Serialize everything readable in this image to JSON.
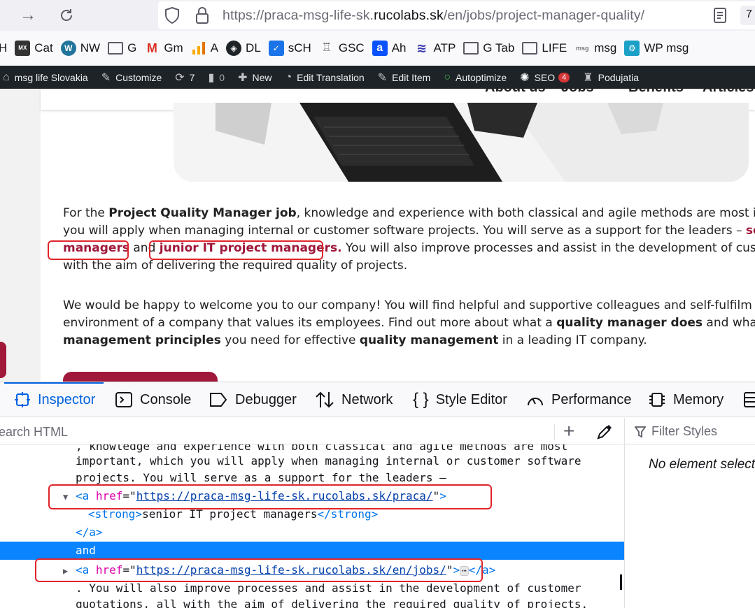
{
  "browser": {
    "url_prefix": "https://praca-msg-life-sk.",
    "url_domain": "rucolabs.sk",
    "url_path": "/en/jobs/project-manager-quality/",
    "extra_label": "7"
  },
  "bookmarks": [
    {
      "label": "H",
      "icon": "none"
    },
    {
      "label": "Cat",
      "icon": "mxs2-icon"
    },
    {
      "label": "NW",
      "icon": "wordpress-icon"
    },
    {
      "label": "G",
      "icon": "folder-icon"
    },
    {
      "label": "Gm",
      "icon": "gmail-icon"
    },
    {
      "label": "A",
      "icon": "analytics-icon"
    },
    {
      "label": "DL",
      "icon": "dl-icon"
    },
    {
      "label": "sCH",
      "icon": "check-icon"
    },
    {
      "label": "GSC",
      "icon": "gsc-icon"
    },
    {
      "label": "Ah",
      "icon": "ahrefs-icon"
    },
    {
      "label": "ATP",
      "icon": "atp-icon"
    },
    {
      "label": "G Tab",
      "icon": "folder-icon"
    },
    {
      "label": "LIFE",
      "icon": "folder-icon"
    },
    {
      "label": "msg",
      "icon": "msg-icon"
    },
    {
      "label": "WP msg",
      "icon": "wp-msg-icon"
    }
  ],
  "adminbar": {
    "site": "msg life Slovakia",
    "customize": "Customize",
    "updates": "7",
    "comments": "0",
    "new": "New",
    "edit_translation": "Edit Translation",
    "edit_item": "Edit Item",
    "autoptimize": "Autoptimize",
    "seo": "SEO",
    "seo_badge": "4",
    "podujatia": "Podujatia"
  },
  "site": {
    "nav": [
      "About us",
      "Jobs",
      "Benefits",
      "Articles"
    ]
  },
  "content": {
    "p1_l1_a": "For the ",
    "p1_l1_b": "Project Quality Manager job",
    "p1_l1_c": ", knowledge and experience with both classical and agile methods are most im",
    "p1_l2_a": "you will apply when managing internal or customer software projects. You will serve as a support for the leaders – ",
    "p1_l2_b": "se",
    "p1_l3_a": "managers",
    "p1_l3_b": " and ",
    "p1_l3_c": "junior IT project managers.",
    "p1_l3_d": " You will also improve processes and assist in the development of custom",
    "p1_l4": "with the aim of delivering the required quality of projects.",
    "p2_l1": "We would be happy to welcome you to our company! You will find helpful and supportive colleagues and self-fulfilm",
    "p2_l2_a": "environment of a company that values its employees. Find out more about what a ",
    "p2_l2_b": "quality manager does",
    "p2_l2_c": " and what c",
    "p2_l3_a": "management principles",
    "p2_l3_b": " you need for effective ",
    "p2_l3_c": "quality management",
    "p2_l3_d": " in a leading IT company."
  },
  "devtools": {
    "tabs": [
      "Inspector",
      "Console",
      "Debugger",
      "Network",
      "Style Editor",
      "Performance",
      "Memory"
    ],
    "search_placeholder": "earch HTML",
    "filter_placeholder": "Filter Styles",
    "no_element": "No element select",
    "lines": {
      "l0": ", knowledge and experience with both classical and agile methods are most",
      "l1": "important, which you will apply when managing internal or customer software",
      "l2": "projects. You will serve as a support for the leaders –",
      "l3_tag": "<a",
      "l3_attr": "href",
      "l3_val": "https://praca-msg-life-sk.rucolabs.sk/praca/",
      "l4_open": "<strong>",
      "l4_text": "senior IT project managers",
      "l4_close": "</strong>",
      "l5": "</a>",
      "l6": "and",
      "l7_tag": "<a",
      "l7_attr": "href",
      "l7_val": "https://praca-msg-life-sk.rucolabs.sk/en/jobs/",
      "l7_ell": "⋯",
      "l7_close": "</a>",
      "l8": ". You will also improve processes and assist in the development of customer",
      "l9": "quotations, all with the aim of delivering the required quality of projects."
    }
  }
}
